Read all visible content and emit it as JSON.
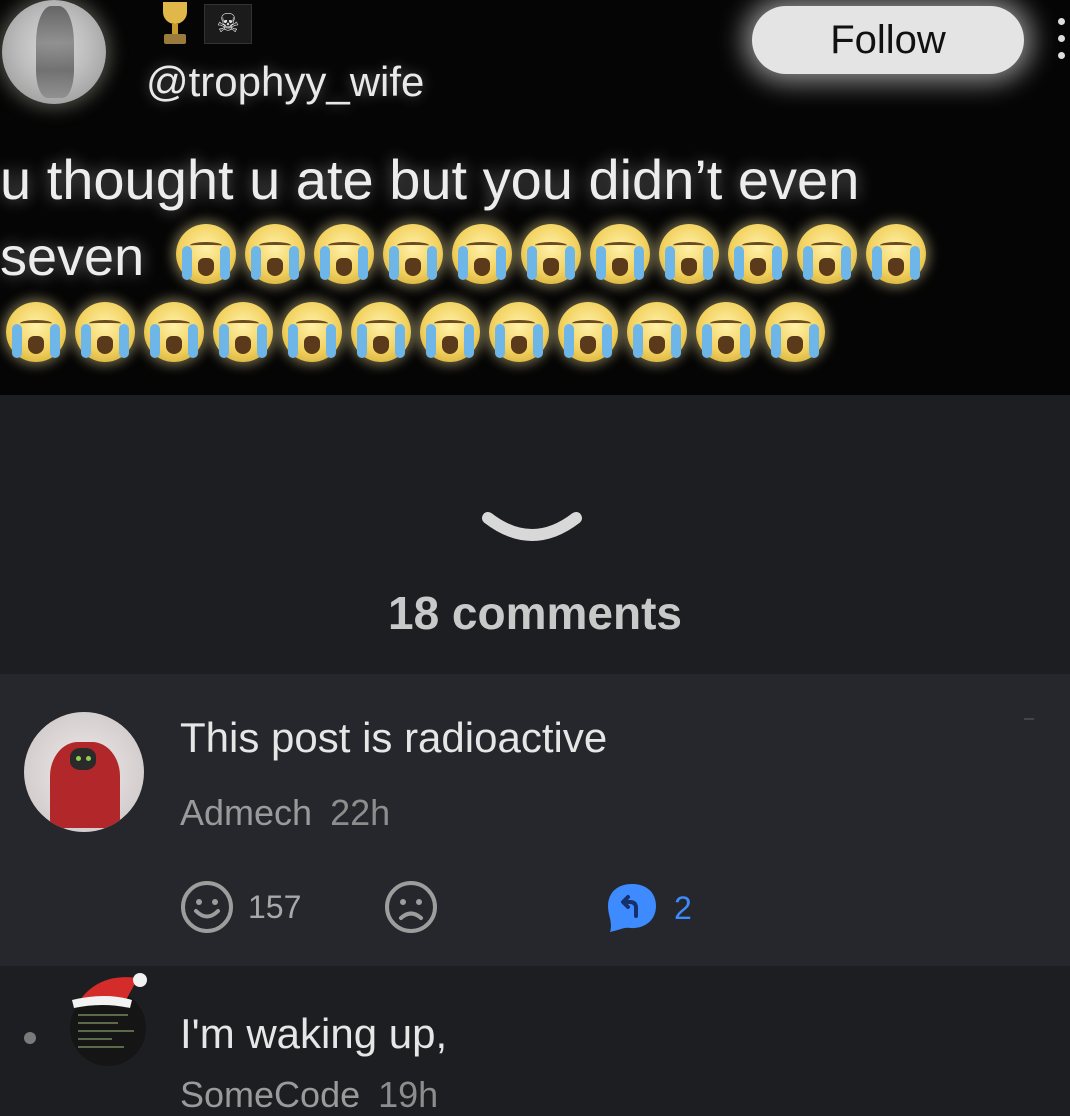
{
  "tweet": {
    "handle": "@trophyy_wife",
    "follow_label": "Follow",
    "text_line1": "u thought u ate but you didn’t even",
    "text_line2": "seven",
    "badges": [
      "trophy-icon",
      "skull-flag-icon"
    ],
    "emoji_name": "loudly-crying-face",
    "emoji_row1_count": 11,
    "emoji_row2_count": 12
  },
  "thread": {
    "expand_icon": "chevron-down-icon",
    "comment_count": "18 comments"
  },
  "comments": [
    {
      "text": "This post is radioactive",
      "author": "Admech",
      "time": "22h",
      "upvotes": "157",
      "replies": "2",
      "icons": [
        "smile-icon",
        "frown-icon",
        "reply-bubble-icon"
      ],
      "accent": "#3d8bff"
    },
    {
      "text": "I'm waking up,",
      "author": "SomeCode",
      "time": "19h"
    }
  ]
}
